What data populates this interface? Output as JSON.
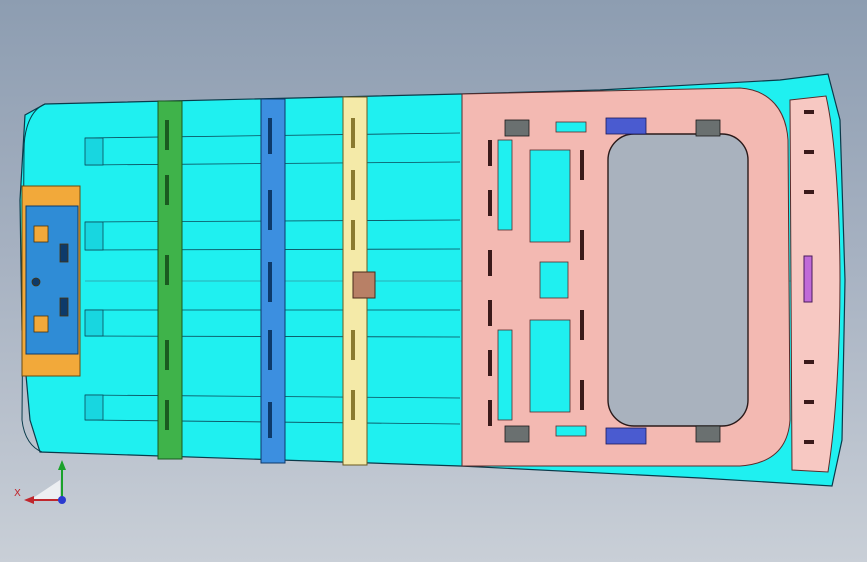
{
  "viewport": {
    "axis_triad": {
      "x_label": "X"
    },
    "colors": {
      "roof_panel": "#1ff0f0",
      "roof_outline": "#0a3a4a",
      "front_bracket": "#f2a93a",
      "front_module": "#2f8cd6",
      "bow_green": "#3fb34a",
      "bow_blue": "#3c8fe0",
      "bow_cream": "#f4eaa8",
      "rear_frame": "#f3b9b2",
      "rear_header": "#f7c8c2",
      "sunroof_opening": "#a9b2be",
      "hinge_clip": "#4a5bd0",
      "latch_magenta": "#c06bd8"
    }
  }
}
